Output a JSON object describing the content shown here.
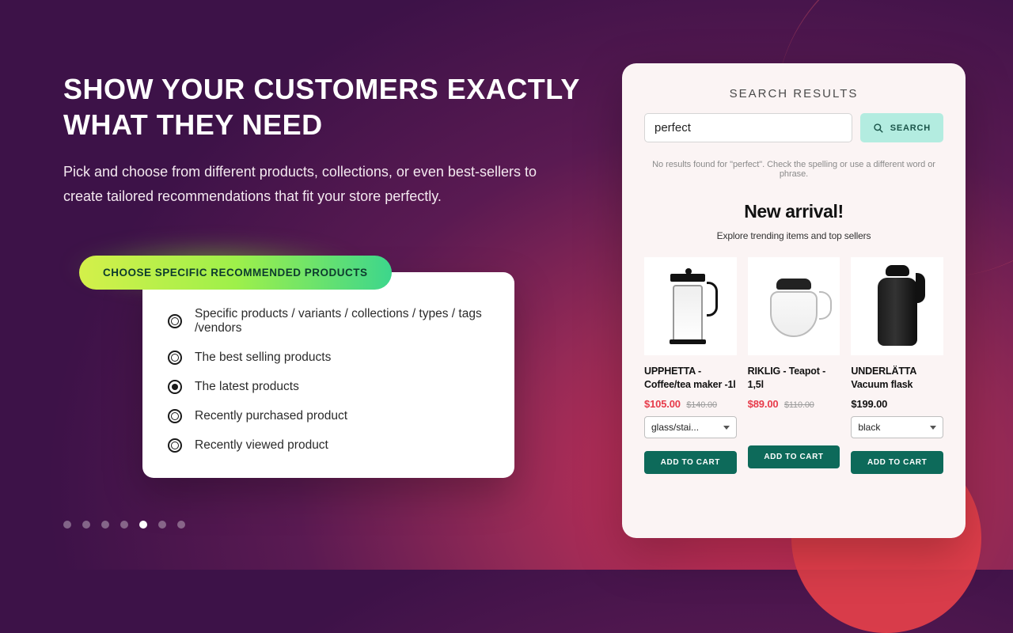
{
  "headline": "SHOW YOUR CUSTOMERS EXACTLY WHAT THEY NEED",
  "subhead": "Pick and choose from different products, collections, or even best-sellers to create tailored recommendations that fit your store perfectly.",
  "config": {
    "pill_label": "CHOOSE SPECIFIC RECOMMENDED PRODUCTS",
    "options": [
      {
        "label": "Specific products / variants / collections / types / tags /vendors",
        "checked": false
      },
      {
        "label": "The best selling products",
        "checked": false
      },
      {
        "label": "The latest products",
        "checked": true
      },
      {
        "label": "Recently purchased product",
        "checked": false
      },
      {
        "label": "Recently viewed product",
        "checked": false
      }
    ]
  },
  "pagination": {
    "total": 7,
    "active_index": 4
  },
  "panel": {
    "title": "SEARCH RESULTS",
    "search_value": "perfect",
    "search_button": "SEARCH",
    "no_results": "No results found for \"perfect\". Check the spelling or use a different word or phrase.",
    "section_title": "New arrival!",
    "section_sub": "Explore trending items and top sellers",
    "add_to_cart_label": "ADD TO CART",
    "products": [
      {
        "name": "UPPHETTA - Coffee/tea maker -1l",
        "price": "$105.00",
        "was": "$140.00",
        "variant": "glass/stai..."
      },
      {
        "name": "RIKLIG - Teapot - 1,5l",
        "price": "$89.00",
        "was": "$110.00",
        "variant": null
      },
      {
        "name": "UNDERLÄTTA Vacuum flask",
        "price": "$199.00",
        "was": null,
        "variant": "black"
      }
    ]
  },
  "colors": {
    "accent_green": "#0d6a5a",
    "sale_red": "#e73b4a",
    "mint": "#b3ece0"
  }
}
